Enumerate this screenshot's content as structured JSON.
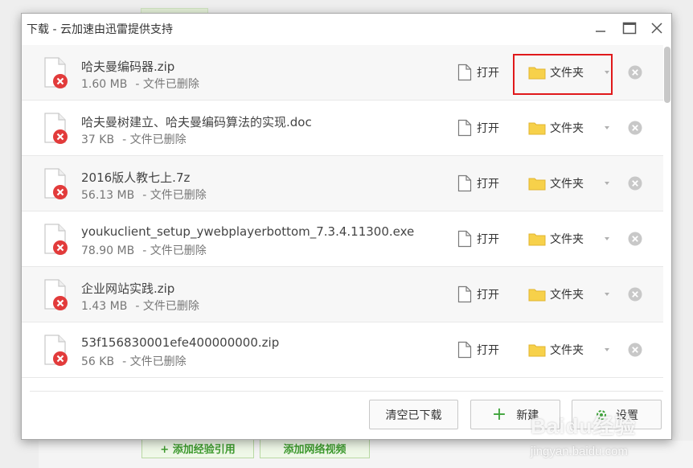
{
  "dialog": {
    "title": "下载 - 云加速由迅雷提供支持"
  },
  "files": [
    {
      "name": "哈夫曼编码器.zip",
      "size": "1.60 MB",
      "status": "- 文件已删除"
    },
    {
      "name": "哈夫曼树建立、哈夫曼编码算法的实现.doc",
      "size": "37 KB",
      "status": "- 文件已删除"
    },
    {
      "name": "2016版人教七上.7z",
      "size": "56.13 MB",
      "status": "- 文件已删除"
    },
    {
      "name": "youkuclient_setup_ywebplayerbottom_7.3.4.11300.exe",
      "size": "78.90 MB",
      "status": "- 文件已删除"
    },
    {
      "name": "企业网站实践.zip",
      "size": "1.43 MB",
      "status": "- 文件已删除"
    },
    {
      "name": "53f156830001efe400000000.zip",
      "size": "56 KB",
      "status": "- 文件已删除"
    }
  ],
  "actions": {
    "open_label": "打开",
    "folder_label": "文件夹"
  },
  "footer": {
    "clear_label": "清空已下载",
    "new_label": "新建",
    "settings_label": "设置"
  },
  "background": {
    "btn_add_quote": "+ 添加经验引用",
    "btn_add_video": "添加网络视频"
  },
  "watermark": {
    "brand": "Baidu经验",
    "url": "jingyan.baidu.com"
  },
  "colors": {
    "highlight": "#e0191b",
    "folder": "#f7d14a",
    "error_badge": "#e23b3b",
    "plus_green": "#3ea33a"
  }
}
